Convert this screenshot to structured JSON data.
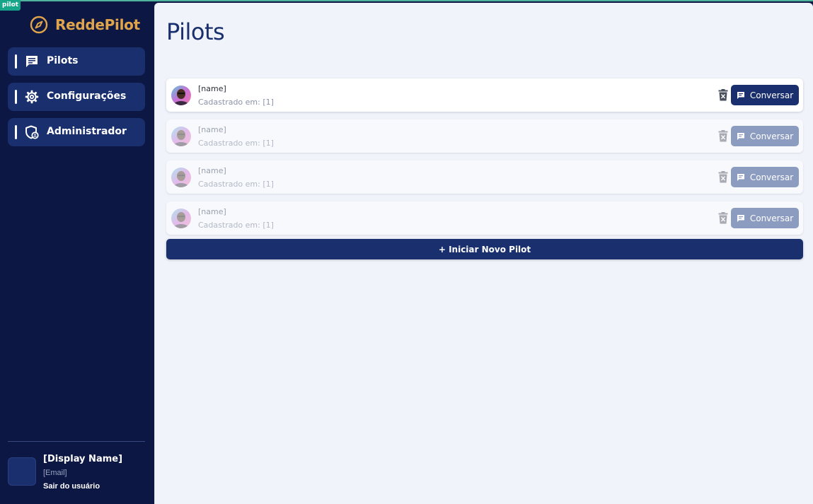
{
  "env_badge": "pilot",
  "brand": {
    "name": "ReddePilot",
    "icon": "compass-icon",
    "color": "#e0a54b"
  },
  "sidebar": {
    "items": [
      {
        "label": "Pilots",
        "icon": "chat-icon"
      },
      {
        "label": "Configurações",
        "icon": "gear-icon"
      },
      {
        "label": "Administrador",
        "icon": "admin-shield-icon"
      }
    ]
  },
  "user": {
    "display_name": "[Display Name]",
    "email": "[Email]",
    "logout_label": "Sair do usuário"
  },
  "main": {
    "title": "Pilots",
    "pilots": [
      {
        "name": "[name]",
        "registered": "Cadastrado em: [1]",
        "action": "Conversar",
        "active": true
      },
      {
        "name": "[name]",
        "registered": "Cadastrado em: [1]",
        "action": "Conversar",
        "active": false
      },
      {
        "name": "[name]",
        "registered": "Cadastrado em: [1]",
        "action": "Conversar",
        "active": false
      },
      {
        "name": "[name]",
        "registered": "Cadastrado em: [1]",
        "action": "Conversar",
        "active": false
      }
    ],
    "new_pilot_label": "+  Iniciar Novo Pilot"
  },
  "colors": {
    "sidebar_bg": "#0c1744",
    "nav_item_bg": "#1a2f6d",
    "main_bg": "#f0f3f9",
    "primary_button": "#1a2f6d",
    "disabled_button": "#8c9bc0"
  }
}
